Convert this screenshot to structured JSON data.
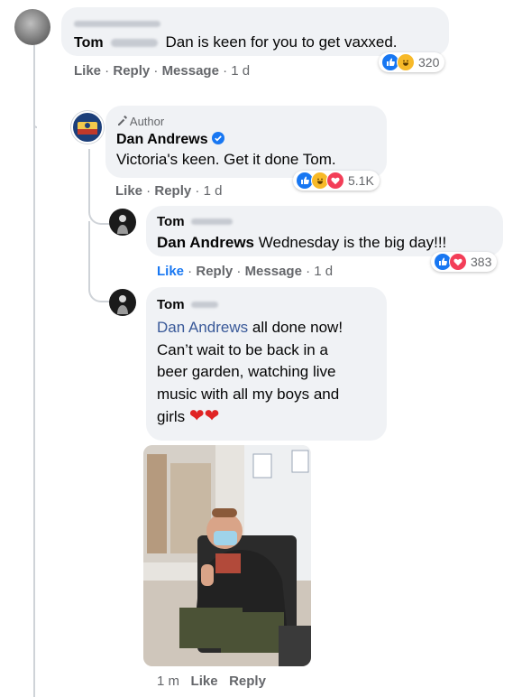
{
  "comment1": {
    "author_first": "Tom",
    "text": "Dan is keen for you to get vaxxed.",
    "actions": [
      "Like",
      "Reply",
      "Message",
      "1 d"
    ],
    "reactions": {
      "icons": [
        "like-icon",
        "haha-icon"
      ],
      "count": "320"
    }
  },
  "comment2": {
    "badge": "Author",
    "author": "Dan Andrews",
    "text": "Victoria's keen. Get it done Tom.",
    "actions": [
      "Like",
      "Reply",
      "1 d"
    ],
    "reactions": {
      "icons": [
        "like-icon",
        "haha-icon",
        "love-icon"
      ],
      "count": "5.1K"
    }
  },
  "comment3": {
    "author_first": "Tom",
    "mention": "Dan Andrews",
    "text": "Wednesday is the big day!!!",
    "actions": [
      "Like",
      "Reply",
      "Message",
      "1 d"
    ],
    "reactions": {
      "icons": [
        "like-icon",
        "love-icon"
      ],
      "count": "383"
    }
  },
  "comment4": {
    "author_first": "Tom",
    "mention": "Dan Andrews",
    "text_lines": [
      "all done now!",
      "Can’t wait to be back in a",
      "beer garden, watching live",
      "music with all my boys and",
      "girls"
    ],
    "emoji": "❤❤",
    "actions": [
      "1 m",
      "Like",
      "Reply"
    ]
  },
  "colors": {
    "link": "#385898",
    "like_blue": "#1877f2",
    "love_red": "#f33e58",
    "haha_yellow": "#f7b928",
    "bubble": "#f0f2f5"
  }
}
